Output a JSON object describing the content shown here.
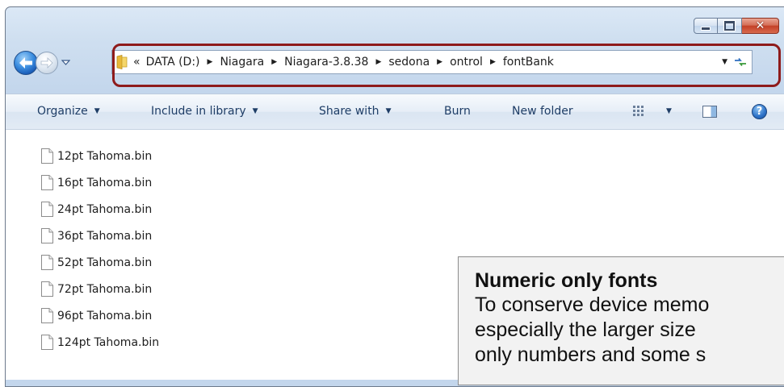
{
  "window": {
    "minimize_icon": "minimize-icon",
    "maximize_icon": "maximize-icon",
    "close_glyph": "✕"
  },
  "navigation": {
    "back_icon": "arrow-left-icon",
    "forward_icon": "arrow-right-icon",
    "recent_icon": "chevron-down-icon"
  },
  "address_bar": {
    "overflow": "«",
    "separator": "▶",
    "crumbs": [
      "DATA (D:)",
      "Niagara",
      "Niagara-3.8.38",
      "sedona",
      "ontrol",
      "fontBank"
    ],
    "dropdown": "▼",
    "refresh_icon": "refresh-icon"
  },
  "toolbar": {
    "organize": "Organize",
    "include_in_library": "Include in library",
    "share_with": "Share with",
    "burn": "Burn",
    "new_folder": "New folder",
    "arrow": "▼",
    "help": "?"
  },
  "files": [
    "12pt Tahoma.bin",
    "16pt Tahoma.bin",
    "24pt Tahoma.bin",
    "36pt Tahoma.bin",
    "52pt Tahoma.bin",
    "72pt Tahoma.bin",
    "96pt Tahoma.bin",
    "124pt Tahoma.bin"
  ],
  "callout": {
    "title": "Numeric only fonts",
    "line1": "To conserve device memo",
    "line2": "especially the larger size",
    "line3": "only numbers and some s"
  },
  "colors": {
    "highlight": "#8e1b1b",
    "toolbar_text": "#1e3d66"
  }
}
